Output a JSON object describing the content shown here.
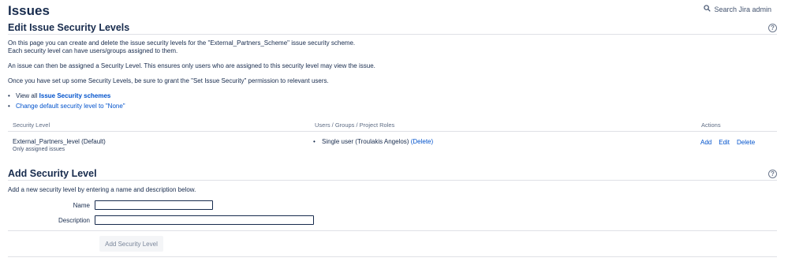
{
  "header": {
    "title": "Issues",
    "search_label": "Search Jira admin"
  },
  "edit_section": {
    "title": "Edit Issue Security Levels",
    "intro_line1": "On this page you can create and delete the issue security levels for the \"External_Partners_Scheme\" issue security scheme.",
    "intro_line2": "Each security level can have users/groups assigned to them.",
    "para2": "An issue can then be assigned a Security Level. This ensures only users who are assigned to this security level may view the issue.",
    "para3": "Once you have set up some Security Levels, be sure to grant the \"Set Issue Security\" permission to relevant users.",
    "links": {
      "view_all_prefix": "View all ",
      "view_all_link": "Issue Security schemes",
      "change_default": "Change default security level to \"None\""
    }
  },
  "table": {
    "headers": {
      "level": "Security Level",
      "members": "Users / Groups / Project Roles",
      "actions": "Actions"
    },
    "rows": [
      {
        "name": "External_Partners_level (Default)",
        "description": "Only assigned issues",
        "member": "Single user (Troulakis Angelos)",
        "member_delete": "(Delete)",
        "actions": [
          "Add",
          "Edit",
          "Delete"
        ]
      }
    ]
  },
  "add_section": {
    "title": "Add Security Level",
    "intro": "Add a new security level by entering a name and description below.",
    "name_label": "Name",
    "name_value": "",
    "description_label": "Description",
    "description_value": "",
    "submit_label": "Add Security Level"
  },
  "colors": {
    "link": "#0052cc",
    "text": "#172b4d",
    "divider": "#dfe1e6"
  }
}
